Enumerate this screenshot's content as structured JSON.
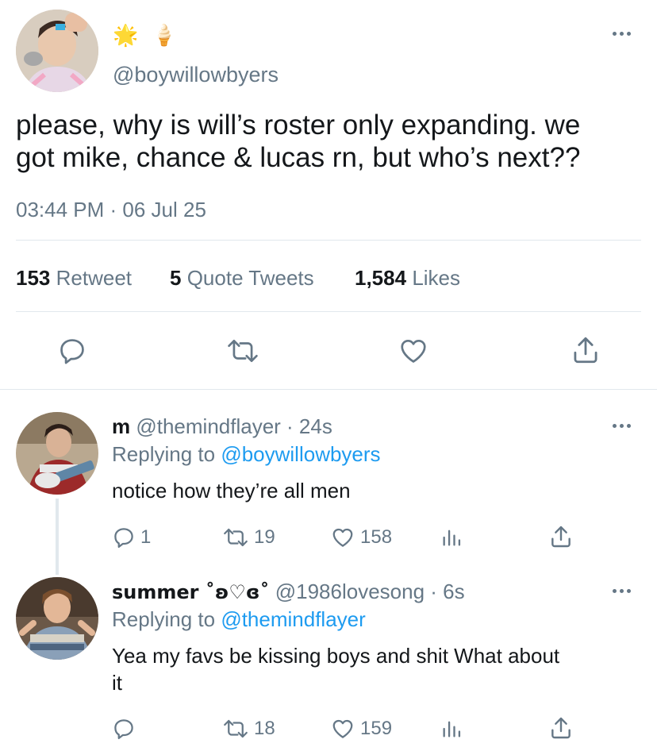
{
  "tweet": {
    "emojis": "🌟 🍦",
    "handle": "@boywillowbyers",
    "text_line1": "please, why is will’s roster only expanding. we",
    "text_line2": "got mike, chance & lucas rn, but who’s next??",
    "timestamp": "03:44 PM · 06 Jul 25",
    "stats": {
      "retweets": "153",
      "retweets_label": "Retweet",
      "quotes": "5",
      "quotes_label": "Quote Tweets",
      "likes": "1,584",
      "likes_label": "Likes"
    }
  },
  "replies": [
    {
      "name": "m",
      "handle_time": "@themindflayer · 24s",
      "replying_prefix": "Replying to",
      "replying_to": "@boywillowbyers",
      "text_line1": "notice how they’re all men",
      "text_line2": "",
      "reply_count": "1",
      "retweet_count": "19",
      "like_count": "158"
    },
    {
      "name": "summer ˚ʚ♡ɞ˚",
      "handle_time": "@1986lovesong · 6s",
      "replying_prefix": "Replying to",
      "replying_to": "@themindflayer",
      "text_line1": "Yea my favs be kissing boys and shit What about",
      "text_line2": "it",
      "reply_count": "",
      "retweet_count": "18",
      "like_count": "159"
    }
  ],
  "colors": {
    "accent": "#1d9bf0",
    "muted": "#657786",
    "text": "#14171a",
    "divider": "#e1e8ed"
  }
}
